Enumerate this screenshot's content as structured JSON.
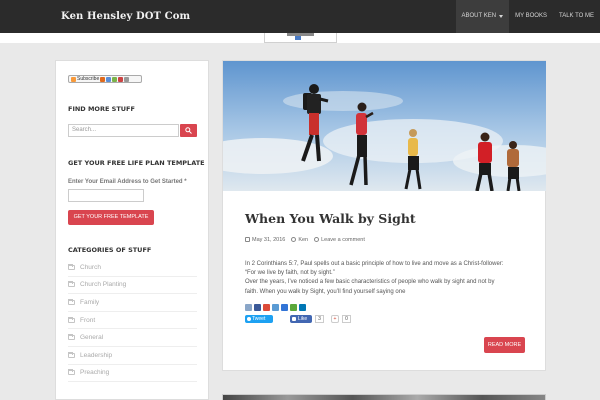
{
  "site": {
    "brand": "Ken Hensley DOT Com"
  },
  "nav": [
    {
      "label": "ABOUT KEN",
      "has_caret": true
    },
    {
      "label": "MY BOOKS",
      "has_caret": false
    },
    {
      "label": "TALK TO ME",
      "has_caret": false
    }
  ],
  "sidebar": {
    "subscribe_label": "Subscribe",
    "find_title": "FIND MORE STUFF",
    "search_placeholder": "Search...",
    "life_title": "GET YOUR FREE LIFE PLAN TEMPLATE",
    "email_label": "Enter Your Email Address to Get Started *",
    "life_button": "GET YOUR FREE TEMPLATE",
    "categories_title": "CATEGORIES OF STUFF",
    "categories": [
      "Church",
      "Church Planting",
      "Family",
      "Front",
      "General",
      "Leadership",
      "Preaching"
    ]
  },
  "post": {
    "title": "When You Walk by Sight",
    "date": "May 31, 2016",
    "author": "Ken",
    "comment_link": "Leave a comment",
    "excerpt": [
      "In 2 Corinthians 5:7, Paul spells out a basic principle of how to live and move as a Christ-follower:",
      "“For we live by faith, not by sight.”",
      "Over the years, I’ve noticed a few basic characteristics of people who walk by sight and not by",
      "faith. When you walk by Sight, you’ll find yourself saying one"
    ],
    "tweet_label": "Tweet",
    "like_label": "Like",
    "like_count": "3",
    "plus_count": "0",
    "read_more": "READ MORE"
  },
  "colors": {
    "accent": "#d9454f",
    "nav_bg": "#2b2b2b",
    "page_bg": "#e9e9e9"
  }
}
